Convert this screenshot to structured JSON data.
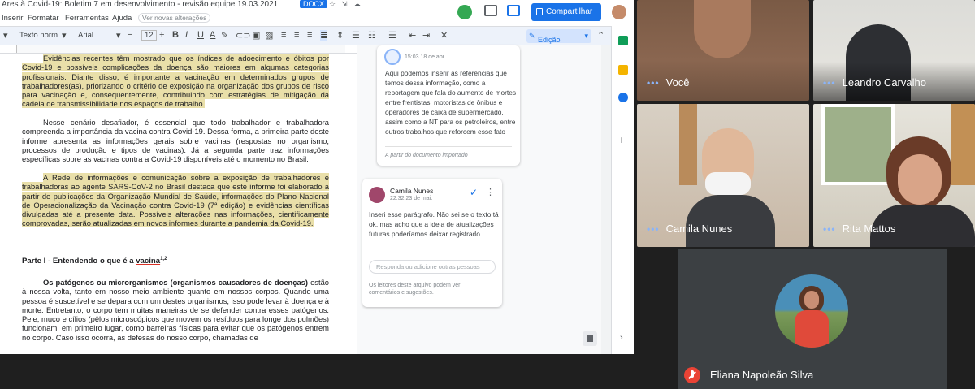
{
  "docs": {
    "title": "Ares à Covid-19: Boletim 7 em desenvolvimento - revisão equipe 19.03.2021",
    "doc_badge": "DOCX",
    "menu": [
      "Inserir",
      "Formatar",
      "Ferramentas",
      "Ajuda"
    ],
    "menu_hint": "Ver novas alterações",
    "share_label": "Compartilhar",
    "toolbar": {
      "style": "Texto norm...",
      "font": "Arial",
      "font_size": "12",
      "mode": "Edição"
    },
    "body": {
      "p1": "Evidências recentes têm mostrado que os índices de adoecimento e óbitos por Covid-19 e possíveis complicações da doença são maiores em algumas categorias profissionais. Diante disso, é importante a vacinação em determinados grupos de trabalhadores(as), priorizando o critério de exposição na organização dos grupos de risco para vacinação e, consequentemente, contribuindo com estratégias de mitigação da cadeia de transmissibilidade nos espaços de trabalho.",
      "p2": "Nesse cenário desafiador, é essencial que todo trabalhador e trabalhadora compreenda a importância da vacina contra Covid-19. Dessa forma, a primeira parte deste informe apresenta as informações gerais sobre vacinas (respostas no organismo, processos de produção e tipos de vacinas). Já a segunda parte traz informações específicas sobre as vacinas contra a Covid-19 disponíveis até o momento no Brasil.",
      "p3": "A Rede de informações e comunicação sobre a exposição de trabalhadores e trabalhadoras ao agente SARS-CoV-2 no Brasil destaca que este informe foi elaborado a partir de publicações da Organização Mundial de Saúde, informações do Plano Nacional de Operacionalização da Vacinação contra Covid-19 (7ª edição) e evidências científicas divulgadas até a presente data. Possíveis alterações nas informações, cientificamente comprovadas, serão atualizadas em novos informes durante a pandemia da Covid-19.",
      "heading_prefix": "Parte I -  Entendendo o que é a ",
      "heading_word": "vacina",
      "heading_sup": "1,2",
      "p4_bold": "Os patógenos ou microrganismos (organismos causadores de doenças)",
      "p4": " estão à nossa volta, tanto em nosso meio ambiente quanto em nossos corpos.  Quando uma pessoa é suscetível e se depara com um destes organismos, isso pode levar à doença e à morte. Entretanto, o corpo tem muitas maneiras de se defender contra esses patógenos. Pele, muco e cílios (pêlos microscópicos que movem os resíduos para longe dos pulmões) funcionam, em primeiro lugar, como barreiras físicas para evitar que os patógenos entrem no corpo. Caso isso ocorra, as defesas do nosso corpo, chamadas de"
    },
    "comment1": {
      "date": "15:03 18 de abr.",
      "text": "Aqui podemos inserir as referências que temos dessa informação, como a reportagem que fala do aumento de mortes entre frentistas, motoristas de ônibus e operadores de caixa de supermercado, assim como a NT para os petroleiros, entre outros trabalhos que reforcem esse fato",
      "source": "A partir do documento importado"
    },
    "comment2": {
      "author": "Camila Nunes",
      "date": "22:32 23 de mai.",
      "text": "Inseri esse parágrafo. Não sei se o texto tá ok, mas acho que a ideia de atualizações futuras poderíamos deixar registrado.",
      "reply_placeholder": "Responda ou adicione outras pessoas",
      "footer": "Os leitores deste arquivo podem ver comentários e sugestões."
    }
  },
  "meet": {
    "participants": [
      {
        "name": "Você"
      },
      {
        "name": "Leandro Carvalho"
      },
      {
        "name": "Camila Nunes"
      },
      {
        "name": "Rita Mattos"
      },
      {
        "name": "Eliana Napoleão Silva"
      }
    ],
    "colors": {
      "dots": "#8ab4f8",
      "mic_off": "#ea4335",
      "background": "#1f1f1f"
    }
  }
}
